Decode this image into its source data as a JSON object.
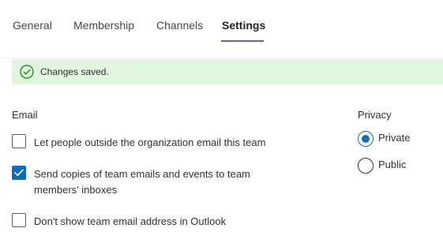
{
  "tabs": {
    "items": [
      {
        "label": "General"
      },
      {
        "label": "Membership"
      },
      {
        "label": "Channels"
      },
      {
        "label": "Settings"
      }
    ],
    "active": "Settings"
  },
  "banner": {
    "icon": "checkmark-circle-icon",
    "message": "Changes saved.",
    "background_color": "#dff6dd",
    "icon_color": "#107c10"
  },
  "email": {
    "heading": "Email",
    "options": [
      {
        "label": "Let people outside the organization email this team",
        "checked": false
      },
      {
        "label": "Send copies of team emails and events to team members' inboxes",
        "checked": true
      },
      {
        "label": "Don't show team email address in Outlook",
        "checked": false
      }
    ]
  },
  "privacy": {
    "heading": "Privacy",
    "options": [
      {
        "label": "Private",
        "selected": true
      },
      {
        "label": "Public",
        "selected": false
      }
    ]
  },
  "colors": {
    "accent": "#0f6cbd",
    "tab_underline": "#6264a7"
  }
}
